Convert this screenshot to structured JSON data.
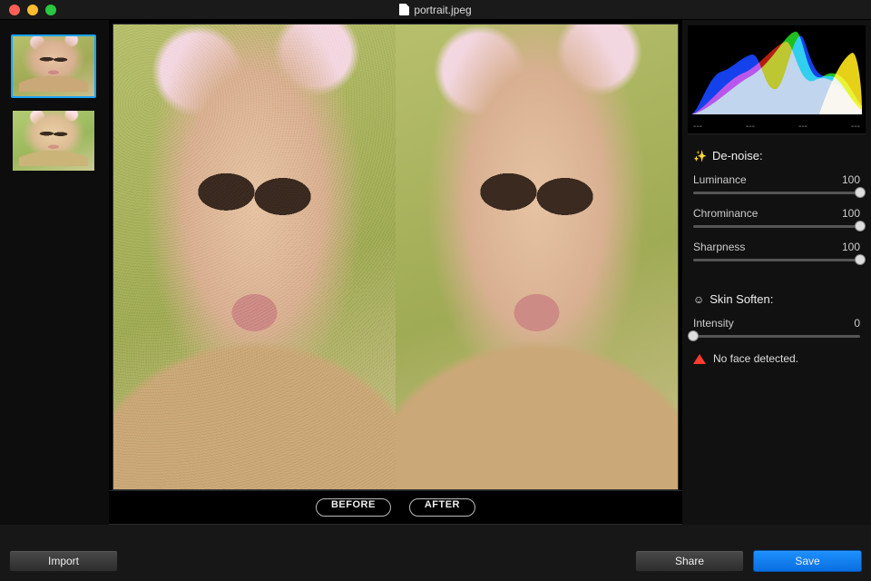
{
  "titlebar": {
    "filename": "portrait.jpeg"
  },
  "thumbnails": [
    {
      "label": "thumb-1",
      "active": true
    },
    {
      "label": "thumb-2",
      "active": false
    }
  ],
  "preview": {
    "before_label": "BEFORE",
    "after_label": "AFTER"
  },
  "histogram": {
    "ticks": [
      "---",
      "---",
      "---",
      "---"
    ]
  },
  "panels": {
    "denoise": {
      "title": "De-noise:",
      "sliders": {
        "luminance": {
          "label": "Luminance",
          "value": "100",
          "pos": 100
        },
        "chrominance": {
          "label": "Chrominance",
          "value": "100",
          "pos": 100
        },
        "sharpness": {
          "label": "Sharpness",
          "value": "100",
          "pos": 100
        }
      }
    },
    "skin": {
      "title": "Skin Soften:",
      "sliders": {
        "intensity": {
          "label": "Intensity",
          "value": "0",
          "pos": 0
        }
      },
      "warning": "No face detected."
    }
  },
  "bottombar": {
    "import_label": "Import",
    "share_label": "Share",
    "save_label": "Save"
  }
}
